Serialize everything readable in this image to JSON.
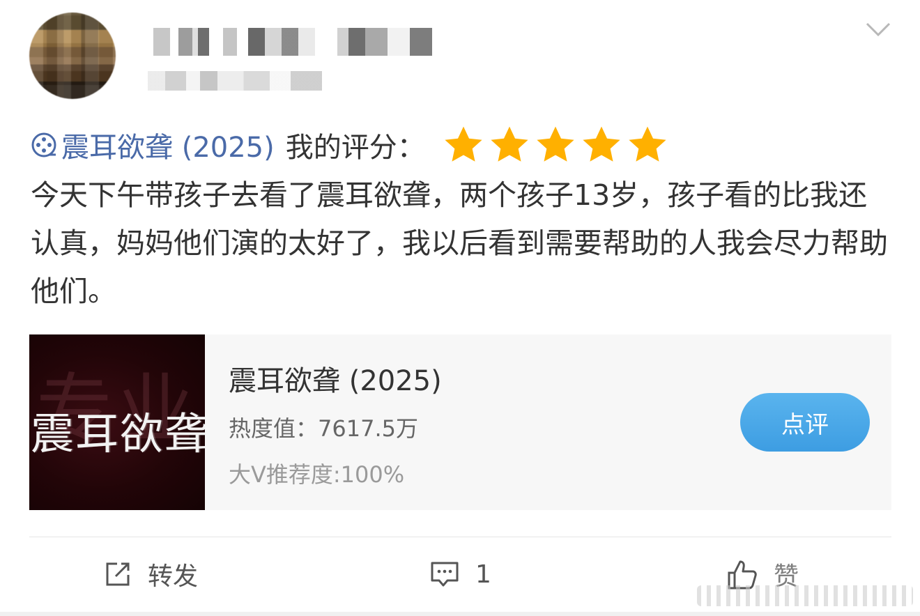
{
  "post": {
    "film_link": "震耳欲聋 (2025)",
    "rating_label": "我的评分：",
    "rating_stars": 5,
    "rating_max": 5,
    "text": "今天下午带孩子去看了震耳欲聋，两个孩子13岁，孩子看的比我还认真，妈妈他们演的太好了，我以后看到需要帮助的人我会尽力帮助他们。"
  },
  "card": {
    "poster_title": "震耳欲聋",
    "poster_bg_text": "专业",
    "title": "震耳欲聋 (2025)",
    "heat": "热度值：7617.5万",
    "recommend": "大V推荐度:100%",
    "review_button": "点评"
  },
  "actions": {
    "repost_label": "转发",
    "comment_count": "1",
    "like_label": "赞"
  },
  "colors": {
    "link": "#4a6aa8",
    "star": "#ffb000",
    "button": "#3d9de2"
  }
}
